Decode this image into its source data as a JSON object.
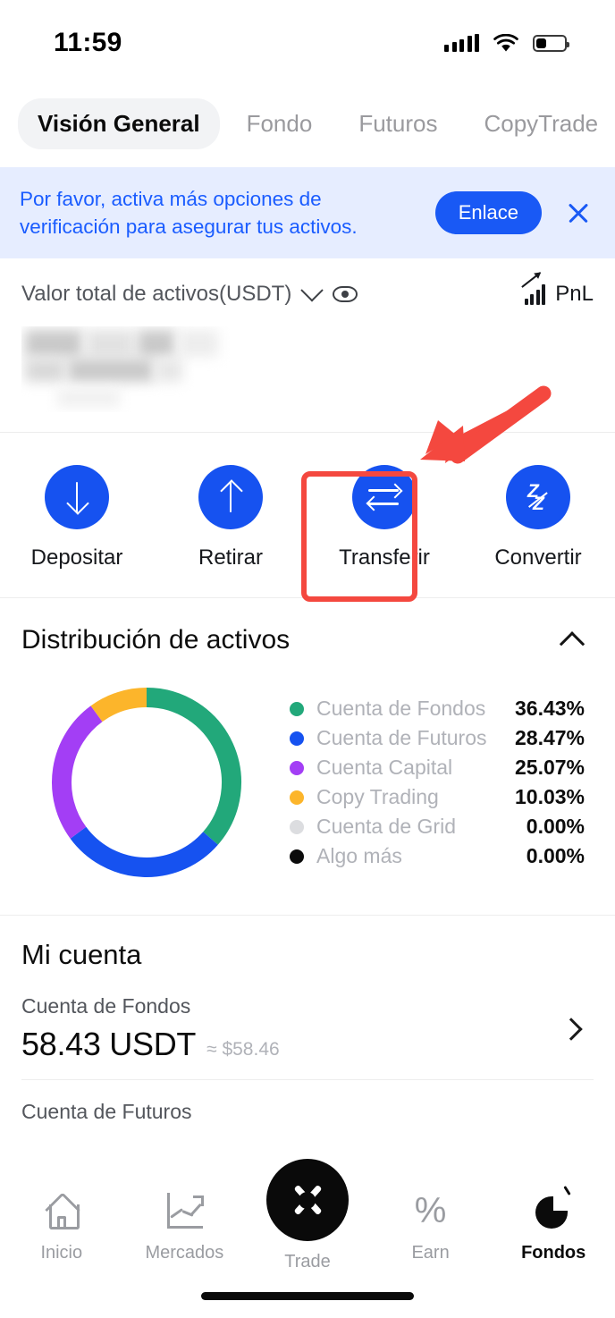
{
  "status_bar": {
    "time": "11:59",
    "signal_icon": "signal-bars-icon",
    "wifi_icon": "wifi-icon",
    "battery_icon": "battery-low-icon"
  },
  "tabs": [
    {
      "label": "Visión General",
      "active": true
    },
    {
      "label": "Fondo",
      "active": false
    },
    {
      "label": "Futuros",
      "active": false
    },
    {
      "label": "CopyTrade",
      "active": false
    }
  ],
  "banner": {
    "text": "Por favor, activa más opciones de verificación para asegurar tus activos.",
    "button_label": "Enlace",
    "close_icon": "close-icon",
    "background_color": "#e6edff",
    "text_color": "#1a5cff",
    "button_color": "#1959f5"
  },
  "assets": {
    "label": "Valor total de activos(USDT)",
    "chevron_icon": "chevron-down-icon",
    "eye_icon": "eye-visibility-icon",
    "pnl_label": "PnL",
    "pnl_icon": "trending-up-chart-icon",
    "balance_hidden": true
  },
  "actions": [
    {
      "label": "Depositar",
      "icon": "arrow-down-icon",
      "highlighted": false
    },
    {
      "label": "Retirar",
      "icon": "arrow-up-icon",
      "highlighted": false
    },
    {
      "label": "Transferir",
      "icon": "swap-arrows-icon",
      "highlighted": true
    },
    {
      "label": "Convertir",
      "icon": "convert-zigzag-icon",
      "highlighted": false
    }
  ],
  "annotation": {
    "highlight_color": "#f4483f",
    "arrow_icon": "pointer-arrow-icon",
    "target": "Transferir"
  },
  "distribution": {
    "title": "Distribución de activos",
    "collapse_icon": "chevron-up-icon"
  },
  "chart_data": {
    "type": "pie",
    "title": "Distribución de activos",
    "categories": [
      "Cuenta de Fondos",
      "Cuenta de Futuros",
      "Cuenta Capital",
      "Copy Trading",
      "Cuenta de Grid",
      "Algo más"
    ],
    "values": [
      36.43,
      28.47,
      25.07,
      10.03,
      0.0,
      0.0
    ],
    "value_labels": [
      "36.43%",
      "28.47%",
      "25.07%",
      "10.03%",
      "0.00%",
      "0.00%"
    ],
    "colors": [
      "#22a87a",
      "#1652f0",
      "#a33ef5",
      "#fcb52b",
      "#dcdde0",
      "#0b0b0b"
    ],
    "legend_position": "right",
    "donut": true,
    "start_angle": 0,
    "xlabel": "",
    "ylabel": ""
  },
  "my_account": {
    "title": "Mi cuenta",
    "chevron_icon": "chevron-right-icon",
    "rows": [
      {
        "name": "Cuenta de Fondos",
        "amount": "58.43 USDT",
        "usd": "≈ $58.46"
      },
      {
        "name": "Cuenta de Futuros",
        "amount": "",
        "usd": ""
      }
    ]
  },
  "bottom_nav": [
    {
      "label": "Inicio",
      "icon": "home-icon",
      "active": false
    },
    {
      "label": "Mercados",
      "icon": "market-chart-icon",
      "active": false
    },
    {
      "label": "Trade",
      "icon": "trade-x-logo-icon",
      "active": false
    },
    {
      "label": "Earn",
      "icon": "percent-icon",
      "active": false
    },
    {
      "label": "Fondos",
      "icon": "pie-chart-icon",
      "active": true
    }
  ]
}
